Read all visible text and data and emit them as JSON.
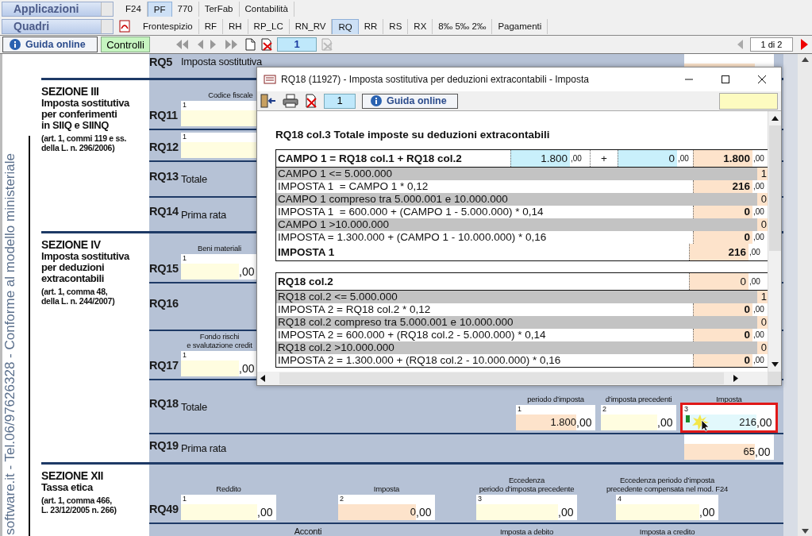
{
  "app_menu": {
    "applications": "Applicazioni",
    "sections": "Quadri"
  },
  "top_tabs": [
    {
      "label": "F24",
      "selected": false
    },
    {
      "label": "PF",
      "selected": true
    },
    {
      "label": "770",
      "selected": false
    },
    {
      "label": "TerFab",
      "selected": false
    },
    {
      "label": "Contabilità",
      "selected": false
    }
  ],
  "form_tabs": [
    {
      "label": "Frontespizio",
      "selected": false
    },
    {
      "label": "RF",
      "selected": false
    },
    {
      "label": "RH",
      "selected": false
    },
    {
      "label": "RP_LC",
      "selected": false
    },
    {
      "label": "RN_RV",
      "selected": false
    },
    {
      "label": "RQ",
      "selected": true
    },
    {
      "label": "RR",
      "selected": false
    },
    {
      "label": "RS",
      "selected": false
    },
    {
      "label": "RX",
      "selected": false
    },
    {
      "label": "8‰ 5‰ 2‰",
      "selected": false
    },
    {
      "label": "Pagamenti",
      "selected": false
    }
  ],
  "toolbar": {
    "guide": "Guida online",
    "checks": "Controlli",
    "page": "1",
    "pager": "1 di 2"
  },
  "side_text": "software.it - Tel.06/97626328 - Conforme al modello ministeriale",
  "sections": [
    {
      "rows": [
        {
          "code": "RQ5",
          "label": "Imposta sostitutiva",
          "fields": [
            {
              "kind": "computed",
              "highlighted": false
            }
          ]
        }
      ]
    },
    {
      "title": "SEZIONE III",
      "subtitle": "Imposta sostitutiva\nper conferimenti\nin SIIQ e SIINQ",
      "note": "(art. 1, commi 119 e ss.\ndella L. n. 296/2006)",
      "rows": [
        {
          "code": "RQ11",
          "fields": [
            {
              "header": "Codice fiscale",
              "number": "1",
              "kind": "input",
              "highlighted": false
            }
          ]
        },
        {
          "code": "RQ12",
          "fields": [
            {
              "number": "1",
              "kind": "input",
              "highlighted": false
            }
          ]
        },
        {
          "code": "RQ13",
          "label": "Totale",
          "fields": []
        },
        {
          "code": "RQ14",
          "label": "Prima rata",
          "fields": []
        }
      ]
    },
    {
      "title": "SEZIONE IV",
      "subtitle": "Imposta sostitutiva\nper deduzioni\nextracontabili",
      "note": "(art. 1, comma 48,\ndella L. n. 244/2007)",
      "rows": [
        {
          "code": "RQ15",
          "fields": [
            {
              "header": "Beni materiali",
              "number": "1",
              "cents": ",00",
              "kind": "input",
              "highlighted": false
            }
          ]
        },
        {
          "code": "RQ16",
          "fields": []
        },
        {
          "code": "RQ17",
          "fields": [
            {
              "header": "Fondo rischi\ne svalutazione credit",
              "number": "1",
              "cents": ",00",
              "kind": "input",
              "highlighted": false
            }
          ]
        },
        {
          "code": "RQ18",
          "label": "Totale",
          "fields": [
            {
              "header": "periodo d’imposta",
              "number": "1",
              "value": "1.800",
              "cents": ",00",
              "kind": "computed",
              "highlighted": false
            },
            {
              "header": "d’imposta precedenti",
              "number": "2",
              "cents": ",00",
              "kind": "input",
              "highlighted": false
            },
            {
              "header": "Imposta",
              "number": "3",
              "value": "216",
              "cents": ",00",
              "kind": "active",
              "highlighted": true
            }
          ]
        },
        {
          "code": "RQ19",
          "label": "Prima rata",
          "fields": [
            {
              "value": "65",
              "cents": ",00",
              "kind": "computed",
              "highlighted": false
            }
          ]
        }
      ]
    },
    {
      "title": "SEZIONE XII",
      "subtitle": "Tassa etica",
      "note": "(art. 1, comma 466,\nL. 23/12/2005 n. 266)",
      "rows": [
        {
          "code": "RQ49",
          "fields": [
            {
              "header": "Reddito",
              "number": "1",
              "cents": ",00",
              "kind": "input",
              "highlighted": false
            },
            {
              "header": "Imposta",
              "number": "2",
              "value": "0",
              "cents": ",00",
              "kind": "computed",
              "highlighted": false
            },
            {
              "header": "Eccedenza\nperiodo d’imposta precedente",
              "number": "3",
              "cents": ",00",
              "kind": "input",
              "highlighted": false
            },
            {
              "header": "Eccedenza periodo d’imposta\nprecedente compensata nel mod. F24",
              "number": "4",
              "cents": ",00",
              "kind": "input",
              "highlighted": false
            }
          ]
        },
        {
          "fields": [
            {
              "header": "Acconti",
              "kind": "group"
            },
            {
              "header": "Imposta a debito",
              "kind": "blank"
            },
            {
              "header": "Imposta a credito",
              "kind": "blank"
            }
          ]
        }
      ]
    }
  ],
  "dialog": {
    "title": "RQ18 (11927) - Imposta sostitutiva per deduzioni extracontabili - Imposta",
    "page": "1",
    "guide": "Guida online",
    "heading": "RQ18 col.3 Totale imposte su deduzioni extracontabili",
    "tables": [
      [
        {
          "kind": "sum",
          "label": "CAMPO 1 = RQ18 col.1 + RQ18 col.2",
          "a": "1.800",
          "a_cents": ",00",
          "op": "+",
          "b": "0",
          "b_cents": ",00",
          "value": "1.800",
          "cents": ",00"
        },
        {
          "kind": "condition",
          "label": "CAMPO 1 <= 5.000.000",
          "value": "1"
        },
        {
          "kind": "amount",
          "label": "IMPOSTA 1  = CAMPO 1 * 0,12",
          "value": "216",
          "cents": ",00"
        },
        {
          "kind": "condition",
          "label": "CAMPO 1 compreso tra 5.000.001 e 10.000.000",
          "value": "0"
        },
        {
          "kind": "amount",
          "label": "IMPOSTA 1  = 600.000 + (CAMPO 1 - 5.000.000) * 0,14",
          "value": "0",
          "cents": ",00"
        },
        {
          "kind": "condition",
          "label": "CAMPO 1 >10.000.000",
          "value": "0"
        },
        {
          "kind": "amount",
          "label": "IMPOSTA = 1.300.000 + (CAMPO 1 - 10.000.000) * 0,16",
          "value": "0",
          "cents": ",00"
        },
        {
          "kind": "total",
          "label": "IMPOSTA 1",
          "value": "216",
          "cents": ",00"
        }
      ],
      [
        {
          "kind": "base",
          "label": "RQ18 col.2",
          "value": "0",
          "cents": ",00"
        },
        {
          "kind": "condition",
          "label": "RQ18 col.2 <= 5.000.000",
          "value": "1"
        },
        {
          "kind": "amount",
          "label": "IMPOSTA 2 = RQ18 col.2 * 0,12",
          "value": "0",
          "cents": ",00"
        },
        {
          "kind": "condition",
          "label": "RQ18 col.2 compreso tra 5.000.001 e 10.000.000",
          "value": "0"
        },
        {
          "kind": "amount",
          "label": "IMPOSTA 2 = 600.000 + (RQ18 col.2 - 5.000.000) * 0,14",
          "value": "0",
          "cents": ",00"
        },
        {
          "kind": "condition",
          "label": "RQ18 col.2 >10.000.000",
          "value": "0"
        },
        {
          "kind": "amount",
          "label": "IMPOSTA 2 = 1.300.000 + (RQ18 col.2 - 10.000.000) * 0,16",
          "value": "0",
          "cents": ",00"
        }
      ]
    ]
  }
}
